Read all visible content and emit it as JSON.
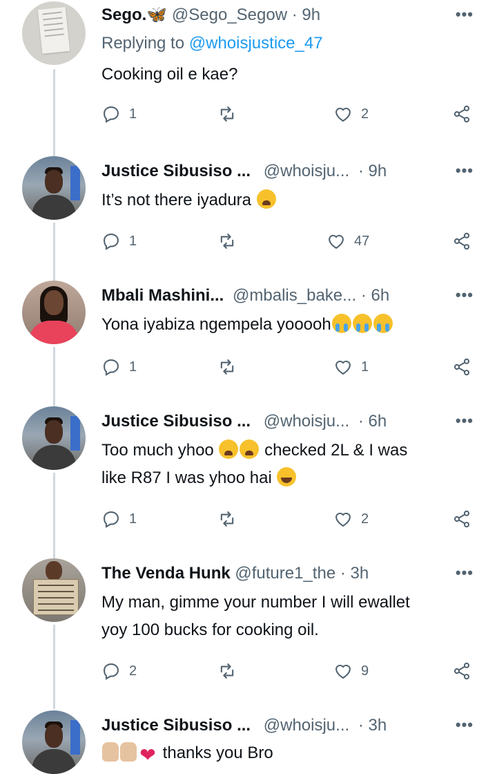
{
  "tweets": [
    {
      "avatar": "paper-note-avatar",
      "name": "Sego.🦋",
      "handle": "@Sego_Segow",
      "time": "· 9h",
      "reply_prefix": "Replying to",
      "reply_mention": "@whoisjustice_47",
      "text": "Cooking oil e kae?",
      "emojis": [],
      "replies": "1",
      "likes": "2"
    },
    {
      "avatar": "justice-avatar",
      "name": "Justice Sibusiso ...",
      "handle": "@whoisju...",
      "time": "· 9h",
      "text": "It’s not there iyadura",
      "emojis": [
        "weary-face"
      ],
      "replies": "1",
      "likes": "47"
    },
    {
      "avatar": "mbali-avatar",
      "name": "Mbali Mashini...",
      "handle": "@mbalis_bake...",
      "time": "· 6h",
      "text": "Yona iyabiza ngempela yooooh",
      "emojis": [
        "loudly-crying-face",
        "loudly-crying-face",
        "loudly-crying-face"
      ],
      "replies": "1",
      "likes": "1"
    },
    {
      "avatar": "justice-avatar",
      "name": "Justice Sibusiso ...",
      "handle": "@whoisju...",
      "time": "· 6h",
      "text_a": "Too much yhoo",
      "text_b": "checked 2L & I was",
      "text_c": "like R87 I was yhoo hai",
      "emojis": [
        "weary-face",
        "weary-face",
        "grinning-squinting-face"
      ],
      "replies": "1",
      "likes": "2"
    },
    {
      "avatar": "venda-hunk-avatar",
      "name": "The Venda Hunk",
      "handle": "@future1_the",
      "time": "· 3h",
      "text_a": "My man, gimme your number I will ewallet",
      "text_b": "yoy 100 bucks for cooking oil.",
      "replies": "2",
      "likes": "9"
    },
    {
      "avatar": "justice-avatar",
      "name": "Justice Sibusiso ...",
      "handle": "@whoisju...",
      "time": "· 3h",
      "text": "thanks you Bro",
      "emojis": [
        "folded-hands",
        "folded-hands",
        "red-heart"
      ]
    }
  ],
  "more_label": "•••",
  "icons": {
    "reply": "reply-icon",
    "retweet": "retweet-icon",
    "like": "like-icon",
    "share": "share-icon"
  },
  "colors": {
    "link": "#1d9bf0",
    "secondary_text": "#536471",
    "thread_line": "#cfd9de"
  }
}
